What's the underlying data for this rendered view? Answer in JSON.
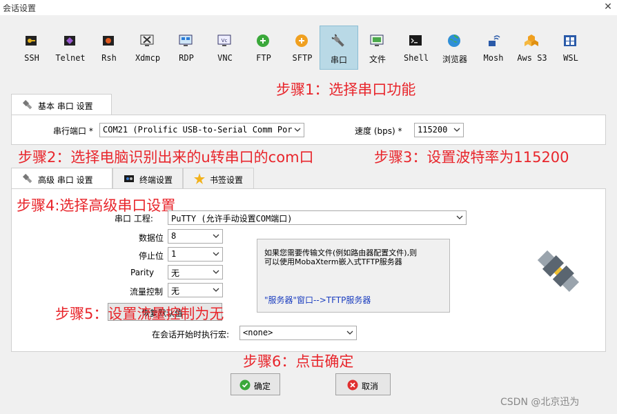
{
  "window": {
    "title": "会话设置",
    "close_glyph": "✕"
  },
  "toolbar": {
    "items": [
      {
        "label": "SSH",
        "icon": "ssh-key-icon"
      },
      {
        "label": "Telnet",
        "icon": "telnet-icon"
      },
      {
        "label": "Rsh",
        "icon": "rsh-icon"
      },
      {
        "label": "Xdmcp",
        "icon": "xdmcp-icon"
      },
      {
        "label": "RDP",
        "icon": "rdp-icon"
      },
      {
        "label": "VNC",
        "icon": "vnc-icon"
      },
      {
        "label": "FTP",
        "icon": "ftp-icon"
      },
      {
        "label": "SFTP",
        "icon": "sftp-icon"
      },
      {
        "label": "串口",
        "icon": "serial-plug-icon"
      },
      {
        "label": "文件",
        "icon": "file-icon"
      },
      {
        "label": "Shell",
        "icon": "shell-icon"
      },
      {
        "label": "浏览器",
        "icon": "browser-globe-icon"
      },
      {
        "label": "Mosh",
        "icon": "mosh-icon"
      },
      {
        "label": "Aws S3",
        "icon": "aws-s3-icon"
      },
      {
        "label": "WSL",
        "icon": "wsl-icon"
      }
    ],
    "active_index": 8
  },
  "annotations": {
    "step1": "步骤1：选择串口功能",
    "step2": "步骤2：选择电脑识别出来的u转串口的com口",
    "step3": "步骤3：设置波特率为115200",
    "step4": "步骤4:选择高级串口设置",
    "step5": "步骤5：设置流量控制为无",
    "step6": "步骤6：点击确定"
  },
  "basic": {
    "tab_label": "基本 串口 设置",
    "port_label": "串行端口 *",
    "port_value": "COM21  (Prolific USB-to-Serial Comm Por",
    "speed_label": "速度 (bps) *",
    "speed_value": "115200"
  },
  "advanced": {
    "tabs": [
      {
        "label": "高级 串口 设置",
        "icon": "plug-icon"
      },
      {
        "label": "终端设置",
        "icon": "terminal-settings-icon"
      },
      {
        "label": "书签设置",
        "icon": "star-icon"
      }
    ],
    "engine_label": "串口 工程:",
    "engine_value": "PuTTY  (允许手动设置COM端口)",
    "databits_label": "数据位",
    "databits_value": "8",
    "stopbits_label": "停止位",
    "stopbits_value": "1",
    "parity_label": "Parity",
    "parity_value": "无",
    "flow_label": "流量控制",
    "flow_value": "无",
    "reset_label": "恢复默认值",
    "macro_label": "在会话开始时执行宏:",
    "macro_value": "<none>",
    "info_line1": "如果您需要传输文件(例如路由器配置文件),则",
    "info_line2": "可以使用MobaXterm嵌入式TFTP服务器",
    "info_link": "\"服务器\"窗口-->TFTP服务器"
  },
  "buttons": {
    "ok": "确定",
    "cancel": "取消"
  },
  "watermark": "CSDN @北京迅为",
  "colors": {
    "annotation": "#e8252b",
    "active_tool": "#b9d9e6",
    "link": "#1a3dbf"
  }
}
